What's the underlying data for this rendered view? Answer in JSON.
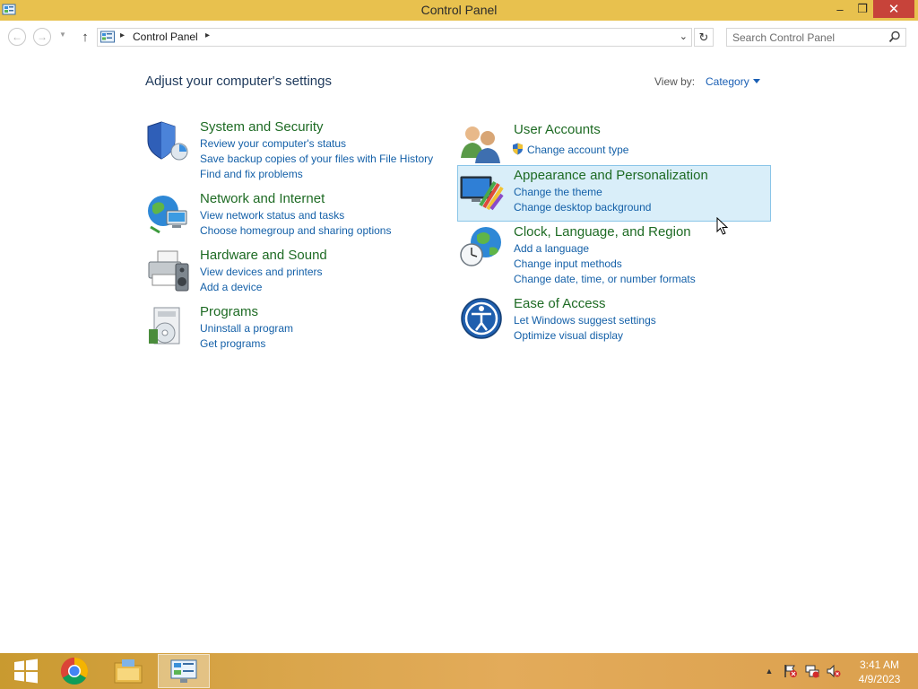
{
  "window": {
    "title": "Control Panel",
    "minimize_glyph": "–",
    "maximize_glyph": "❐",
    "close_glyph": "✕"
  },
  "navbar": {
    "back_glyph": "←",
    "forward_glyph": "→",
    "recent_glyph": "▼",
    "up_glyph": "↑",
    "breadcrumb": "Control Panel",
    "breadcrumb_sep": "▸",
    "dropdown_glyph": "⌄",
    "refresh_glyph": "↻",
    "search_placeholder": "Search Control Panel"
  },
  "header": {
    "title": "Adjust your computer's settings",
    "view_by_label": "View by:",
    "view_by_value": "Category"
  },
  "categories": {
    "system": {
      "title": "System and Security",
      "links": [
        "Review your computer's status",
        "Save backup copies of your files with File History",
        "Find and fix problems"
      ]
    },
    "network": {
      "title": "Network and Internet",
      "links": [
        "View network status and tasks",
        "Choose homegroup and sharing options"
      ]
    },
    "hardware": {
      "title": "Hardware and Sound",
      "links": [
        "View devices and printers",
        "Add a device"
      ]
    },
    "programs": {
      "title": "Programs",
      "links": [
        "Uninstall a program",
        "Get programs"
      ]
    },
    "users": {
      "title": "User Accounts",
      "links": [
        "Change account type"
      ]
    },
    "appearance": {
      "title": "Appearance and Personalization",
      "links": [
        "Change the theme",
        "Change desktop background"
      ]
    },
    "clock": {
      "title": "Clock, Language, and Region",
      "links": [
        "Add a language",
        "Change input methods",
        "Change date, time, or number formats"
      ]
    },
    "ease": {
      "title": "Ease of Access",
      "links": [
        "Let Windows suggest settings",
        "Optimize visual display"
      ]
    }
  },
  "taskbar": {
    "tray_up_glyph": "▲",
    "time": "3:41 AM",
    "date": "4/9/2023"
  },
  "colors": {
    "title_bar": "#e8c14e",
    "close_button": "#c7433a",
    "category_title": "#1e6b24",
    "link": "#1460a8",
    "highlight": "#d9eef9"
  }
}
